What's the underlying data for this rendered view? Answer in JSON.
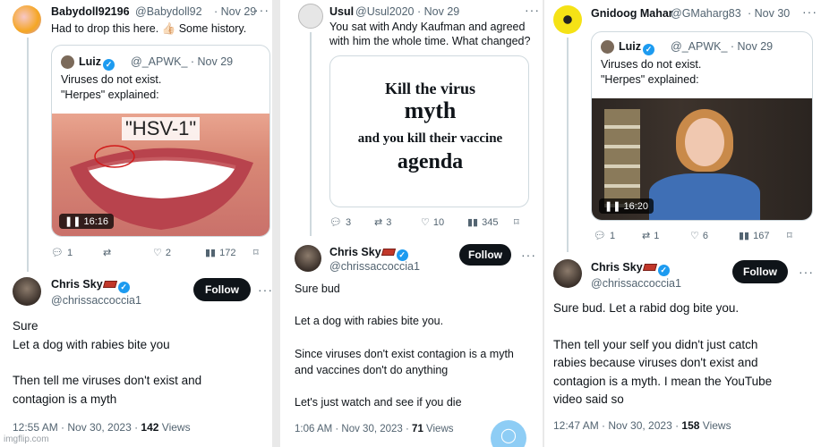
{
  "panel1": {
    "name": "Babydoll92196",
    "handle": "@Babydoll92",
    "time": "· Nov 29",
    "more": "···",
    "text": "Had to drop this here. 👍🏻 Some history.",
    "quote": {
      "name": "Luiz",
      "handle": "@_APWK_ · Nov 29",
      "text1": "Viruses do not exist.",
      "text2": "\"Herpes\" explained:",
      "image_label": "\"HSV-1\"",
      "video_time": "❚❚ 16:16"
    },
    "actions": {
      "replies": "1",
      "likes": "2",
      "views": "172"
    },
    "reply": {
      "name": "Chris Sky",
      "handle": "@chrissaccoccia1",
      "follow": "Follow",
      "lines": [
        "Sure",
        "Let a dog with rabies bite you",
        "",
        "Then tell me viruses don't exist and",
        "contagion is a myth"
      ],
      "meta_prefix": "12:55 AM · Nov 30, 2023 · ",
      "views_count": "142",
      "views_label": " Views"
    }
  },
  "panel2": {
    "name": "Usul",
    "handle": "@Usul2020 · Nov 29",
    "more": "···",
    "text1": "You sat with Andy Kaufman and agreed",
    "text2": "with him the whole time. What changed?",
    "card": {
      "line1": "Kill the virus",
      "line2": "myth",
      "line3": "and you kill their vaccine",
      "line4": "agenda"
    },
    "actions": {
      "replies": "3",
      "retweets": "3",
      "likes": "10",
      "views": "345"
    },
    "reply": {
      "name": "Chris Sky",
      "handle": "@chrissaccoccia1",
      "follow": "Follow",
      "lines": [
        "Sure bud",
        "",
        "Let a dog with rabies bite you.",
        "",
        "Since viruses don't exist contagion is a myth",
        "and vaccines don't do anything",
        "",
        "Let's just watch and see if you die"
      ],
      "meta_prefix": "1:06 AM · Nov 30, 2023 · ",
      "views_count": "71",
      "views_label": " Views"
    }
  },
  "panel3": {
    "name": "Gnidoog Mahar",
    "handle": "@GMaharg83",
    "time": "· Nov 30",
    "more": "···",
    "quote": {
      "name": "Luiz",
      "handle": "@_APWK_ · Nov 29",
      "text1": "Viruses do not exist.",
      "text2": "\"Herpes\" explained:",
      "video_time": "❚❚ 16:20"
    },
    "actions": {
      "replies": "1",
      "retweets": "1",
      "likes": "6",
      "views": "167"
    },
    "reply": {
      "name": "Chris Sky",
      "handle": "@chrissaccoccia1",
      "follow": "Follow",
      "lines": [
        "Sure bud. Let a rabid dog bite you.",
        "",
        "Then tell your self you didn't just catch",
        "rabies because viruses don't exist and",
        "contagion is a myth. I mean the YouTube",
        "video said so"
      ],
      "meta_prefix": "12:47 AM · Nov 30, 2023 · ",
      "views_count": "158",
      "views_label": " Views"
    }
  },
  "watermark": "imgflip.com",
  "colors": {
    "accent": "#1d9bf0",
    "text": "#0f1419",
    "muted": "#536471",
    "border": "#cfd9de"
  }
}
